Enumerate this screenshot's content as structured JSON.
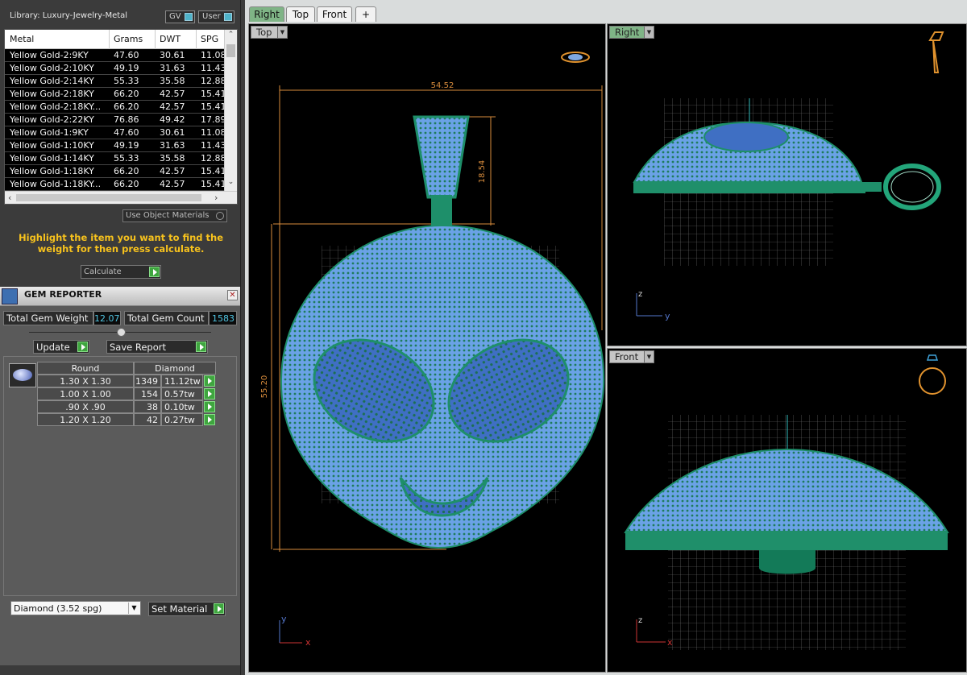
{
  "library": {
    "title": "Library: Luxury-Jewelry-Metal",
    "toggles": [
      "GV",
      "User"
    ],
    "columns": [
      "Metal",
      "Grams",
      "DWT",
      "SPG"
    ],
    "rows": [
      [
        "Yellow Gold-2:9KY",
        "47.60",
        "30.61",
        "11.08"
      ],
      [
        "Yellow Gold-2:10KY",
        "49.19",
        "31.63",
        "11.43"
      ],
      [
        "Yellow Gold-2:14KY",
        "55.33",
        "35.58",
        "12.88"
      ],
      [
        "Yellow Gold-2:18KY",
        "66.20",
        "42.57",
        "15.41"
      ],
      [
        "Yellow Gold-2:18KY...",
        "66.20",
        "42.57",
        "15.41"
      ],
      [
        "Yellow Gold-2:22KY",
        "76.86",
        "49.42",
        "17.89"
      ],
      [
        "Yellow Gold-1:9KY",
        "47.60",
        "30.61",
        "11.08"
      ],
      [
        "Yellow Gold-1:10KY",
        "49.19",
        "31.63",
        "11.43"
      ],
      [
        "Yellow Gold-1:14KY",
        "55.33",
        "35.58",
        "12.88"
      ],
      [
        "Yellow Gold-1:18KY",
        "66.20",
        "42.57",
        "15.41"
      ],
      [
        "Yellow Gold-1:18KY...",
        "66.20",
        "42.57",
        "15.41"
      ]
    ],
    "use_object_materials": "Use Object Materials",
    "hint": "Highlight the item you want to find the weight for then press calculate.",
    "calculate_label": "Calculate"
  },
  "gem_reporter": {
    "title": "GEM REPORTER",
    "total_weight_label": "Total Gem Weight",
    "total_weight": "12.07",
    "total_count_label": "Total Gem Count",
    "total_count": "1583",
    "update_label": "Update",
    "save_report_label": "Save Report",
    "header": [
      "Round",
      "Diamond"
    ],
    "gems": [
      {
        "size": "1.30 X 1.30",
        "count": "1349",
        "weight": "11.12tw"
      },
      {
        "size": "1.00 X 1.00",
        "count": "154",
        "weight": "0.57tw"
      },
      {
        "size": ".90 X .90",
        "count": "38",
        "weight": "0.10tw"
      },
      {
        "size": "1.20 X 1.20",
        "count": "42",
        "weight": "0.27tw"
      }
    ],
    "material_selected": "Diamond     (3.52 spg)",
    "set_material_label": "Set Material"
  },
  "view_tabs": [
    "Right",
    "Top",
    "Front",
    "+"
  ],
  "viewports": {
    "top": {
      "label": "Top",
      "dim_width": "54.52",
      "dim_height": "55.20",
      "dim_bail": "18.54",
      "axis_x": "x",
      "axis_y": "y"
    },
    "right": {
      "label": "Right",
      "axis_h": "y",
      "axis_v": "z"
    },
    "front": {
      "label": "Front",
      "axis_h": "x",
      "axis_v": "z"
    }
  },
  "colors": {
    "gem_blue": "#5b8fd6",
    "metal_green": "#1e8f6a",
    "dim_orange": "#e09040",
    "active_tab": "#7fb486"
  }
}
